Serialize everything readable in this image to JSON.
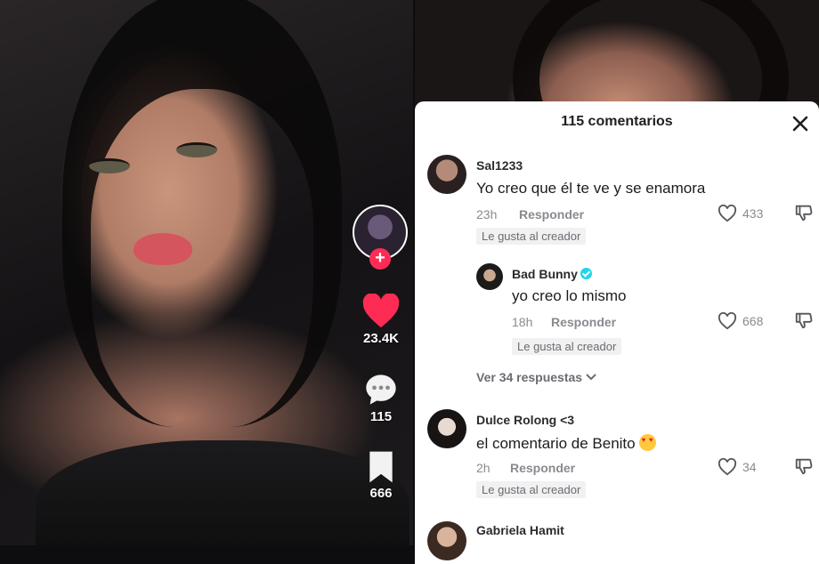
{
  "video": {
    "likes": "23.4K",
    "comments": "115",
    "saves": "666"
  },
  "comments_panel": {
    "title": "115 comentarios",
    "comments": [
      {
        "user": "Sal1233",
        "text": "Yo creo que él te ve y se enamora",
        "time": "23h",
        "reply": "Responder",
        "likes": "433",
        "badge": "Le gusta al creador"
      },
      {
        "user": "Bad Bunny",
        "text": "yo creo lo mismo",
        "time": "18h",
        "reply": "Responder",
        "likes": "668",
        "badge": "Le gusta al creador"
      },
      {
        "user": "Dulce Rolong <3",
        "text": "el comentario de Benito",
        "time": "2h",
        "reply": "Responder",
        "likes": "34",
        "badge": "Le gusta al creador"
      },
      {
        "user": "Gabriela Hamit"
      }
    ],
    "view_replies": "Ver 34 respuestas"
  },
  "colors": {
    "accent": "#fe2c55",
    "verified": "#20d5ec",
    "heart": "#fe2c55"
  },
  "icons": [
    "heart-icon",
    "comment-icon",
    "bookmark-icon",
    "close-icon",
    "like-icon",
    "dislike-icon",
    "verified-icon",
    "chevron-down-icon",
    "heart-eyes-emoji-icon"
  ]
}
